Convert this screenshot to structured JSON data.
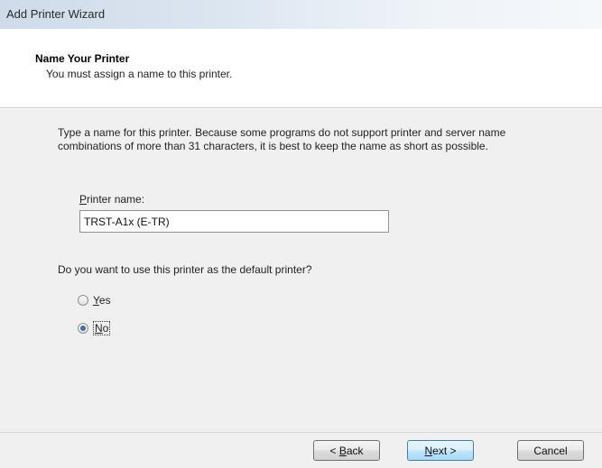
{
  "window": {
    "title": "Add Printer Wizard"
  },
  "header": {
    "title": "Name Your Printer",
    "subtitle": "You must assign a name to this printer."
  },
  "main": {
    "description": "Type a name for this printer. Because some programs do not support printer and server name combinations of more than 31 characters, it is best to keep the name as short as possible.",
    "printer_name_label_first": "P",
    "printer_name_label_rest": "rinter name:",
    "printer_name_value": "TRST-A1x (E-TR)",
    "default_question": "Do you want to use this printer as the default printer?",
    "options": [
      {
        "label_first": "Y",
        "label_rest": "es",
        "selected": false
      },
      {
        "label_first": "N",
        "label_rest": "o",
        "selected": true
      }
    ]
  },
  "footer": {
    "back_prefix": "< ",
    "back_first": "B",
    "back_rest": "ack",
    "next_first": "N",
    "next_rest": "ext >",
    "cancel_label": "Cancel"
  }
}
